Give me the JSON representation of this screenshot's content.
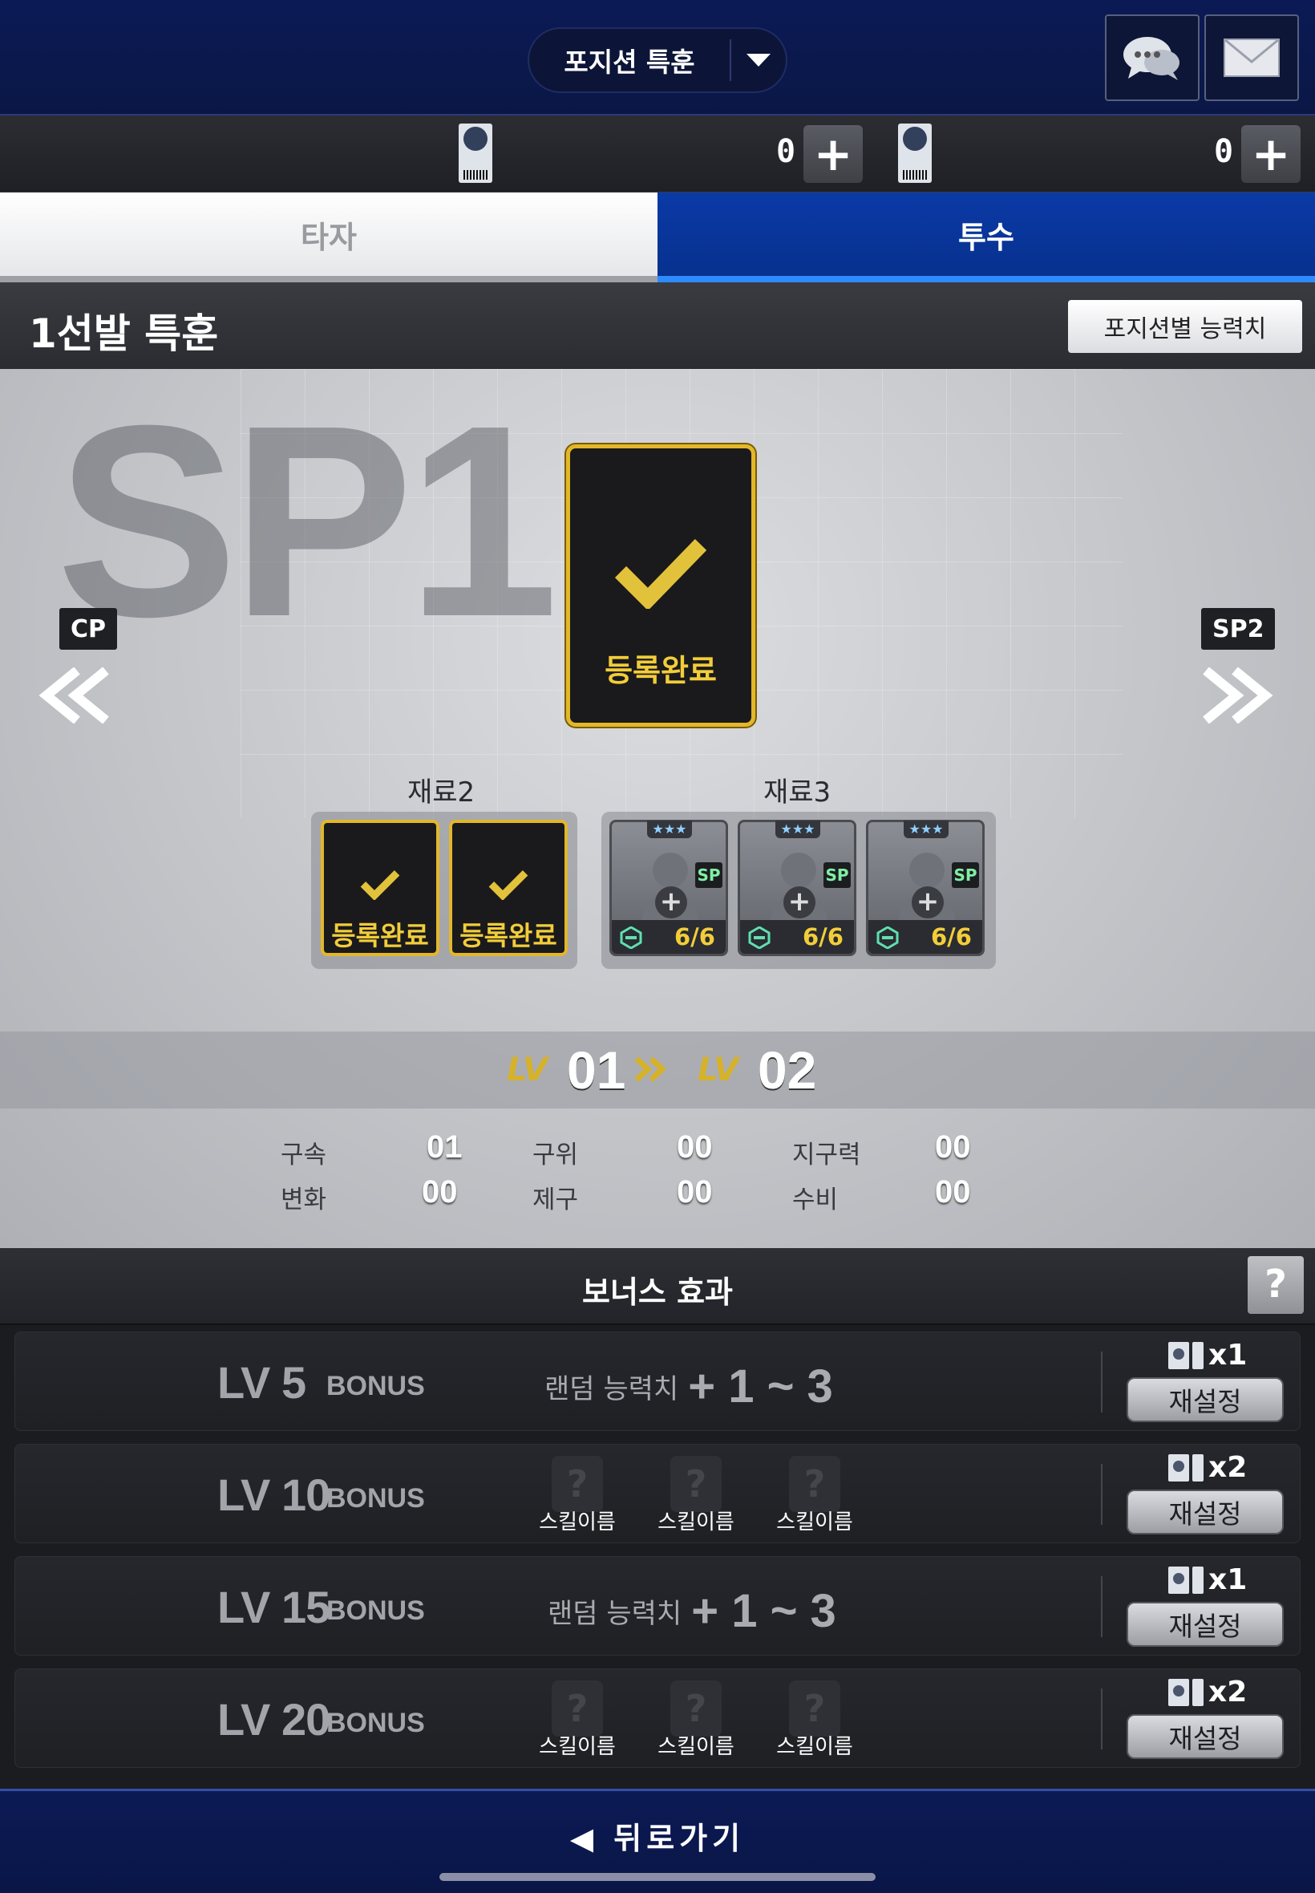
{
  "header": {
    "title": "포지션 특훈"
  },
  "currency": [
    {
      "value": "0"
    },
    {
      "value": "0"
    }
  ],
  "tabs": [
    {
      "label": "타자",
      "active": false
    },
    {
      "label": "투수",
      "active": true
    }
  ],
  "section": {
    "title": "1선발 특훈",
    "stats_button": "포지션별 능력치"
  },
  "main": {
    "watermark": "SP1",
    "prev_position": "CP",
    "next_position": "SP2",
    "main_card_status": "등록완료",
    "material2_label": "재료2",
    "material3_label": "재료3",
    "material2_cards": [
      {
        "status": "등록완료"
      },
      {
        "status": "등록완료"
      }
    ],
    "material3_slots": [
      {
        "stars": "★★★",
        "badge": "SP",
        "count": "6/6"
      },
      {
        "stars": "★★★",
        "badge": "SP",
        "count": "6/6"
      },
      {
        "stars": "★★★",
        "badge": "SP",
        "count": "6/6"
      }
    ],
    "level": {
      "lv_label": "LV",
      "current": "01",
      "next": "02"
    },
    "stats": [
      {
        "label": "구속",
        "value": "01"
      },
      {
        "label": "구위",
        "value": "00"
      },
      {
        "label": "지구력",
        "value": "00"
      },
      {
        "label": "변화",
        "value": "00"
      },
      {
        "label": "제구",
        "value": "00"
      },
      {
        "label": "수비",
        "value": "00"
      }
    ]
  },
  "bonus": {
    "title": "보너스 효과",
    "help": "?",
    "rows": [
      {
        "lv": "LV 5",
        "word": "BONUS",
        "type": "random",
        "text": "랜덤 능력치",
        "range": "+ 1 ~ 3",
        "cost": "x1",
        "reset": "재설정"
      },
      {
        "lv": "LV 10",
        "word": "BONUS",
        "type": "skill",
        "skills": [
          "스킬이름",
          "스킬이름",
          "스킬이름"
        ],
        "cost": "x2",
        "reset": "재설정"
      },
      {
        "lv": "LV 15",
        "word": "BONUS",
        "type": "random",
        "text": "랜덤 능력치",
        "range": "+ 1 ~ 3",
        "cost": "x1",
        "reset": "재설정"
      },
      {
        "lv": "LV 20",
        "word": "BONUS",
        "type": "skill",
        "skills": [
          "스킬이름",
          "스킬이름",
          "스킬이름"
        ],
        "cost": "x2",
        "reset": "재설정"
      }
    ]
  },
  "footer": {
    "back": "◀ 뒤로가기"
  },
  "colors": {
    "accent_blue": "#08318f",
    "gold": "#e2b72a",
    "tab_highlight": "#2e8bff"
  }
}
